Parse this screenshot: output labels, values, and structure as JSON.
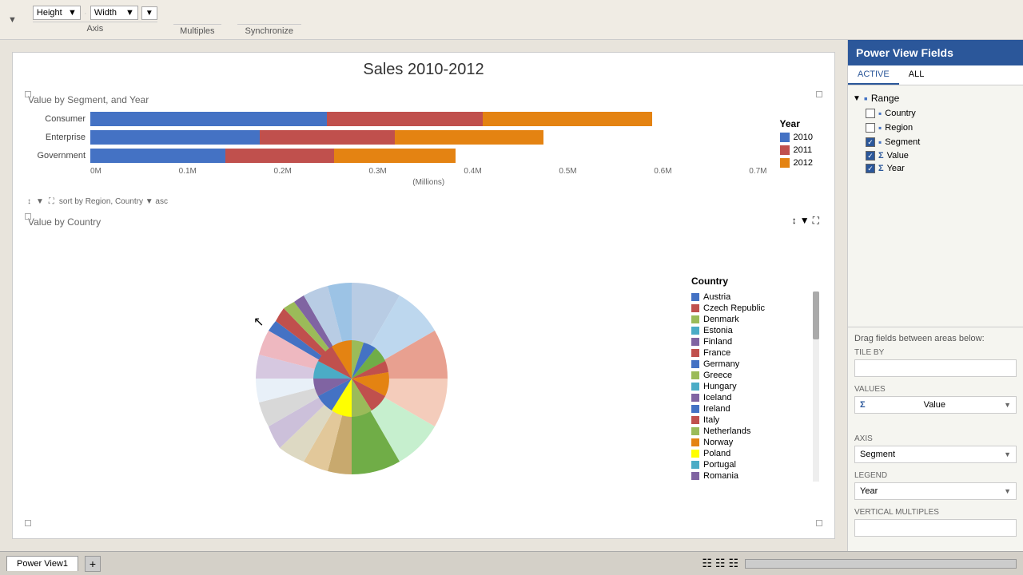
{
  "toolbar": {
    "groups": [
      {
        "label": "Axis",
        "buttons": [
          "Height",
          "Width"
        ]
      },
      {
        "label": "Multiples",
        "buttons": []
      },
      {
        "label": "Synchronize",
        "buttons": []
      }
    ]
  },
  "chart": {
    "title": "Sales 2010-2012",
    "bar_section_title": "Value by Segment, and Year",
    "pie_section_title": "Value by Country",
    "sort_text": "sort by  Region, Country  ▼  asc",
    "year_legend": {
      "title": "Year",
      "items": [
        {
          "label": "2010",
          "color": "#4472C4"
        },
        {
          "label": "2011",
          "color": "#C0504D"
        },
        {
          "label": "2012",
          "color": "#E48312"
        }
      ]
    },
    "bar_rows": [
      {
        "label": "Consumer",
        "segments": [
          {
            "color": "#4472C4",
            "width": "35%"
          },
          {
            "color": "#C0504D",
            "width": "23%"
          },
          {
            "color": "#E48312",
            "width": "25%"
          }
        ]
      },
      {
        "label": "Enterprise",
        "segments": [
          {
            "color": "#4472C4",
            "width": "25%"
          },
          {
            "color": "#C0504D",
            "width": "20%"
          },
          {
            "color": "#E48312",
            "width": "22%"
          }
        ]
      },
      {
        "label": "Government",
        "segments": [
          {
            "color": "#4472C4",
            "width": "20%"
          },
          {
            "color": "#C0504D",
            "width": "16%"
          },
          {
            "color": "#E48312",
            "width": "18%"
          }
        ]
      }
    ],
    "axis_labels": [
      "0M",
      "0.1M",
      "0.2M",
      "0.3M",
      "0.4M",
      "0.5M",
      "0.6M",
      "0.7M"
    ],
    "axis_unit": "(Millions)",
    "country_legend": {
      "title": "Country",
      "items": [
        {
          "label": "Austria",
          "color": "#4472C4"
        },
        {
          "label": "Czech Republic",
          "color": "#C0504D"
        },
        {
          "label": "Denmark",
          "color": "#9BBB59"
        },
        {
          "label": "Estonia",
          "color": "#4BACC6"
        },
        {
          "label": "Finland",
          "color": "#8064A2"
        },
        {
          "label": "France",
          "color": "#C0504D"
        },
        {
          "label": "Germany",
          "color": "#4472C4"
        },
        {
          "label": "Greece",
          "color": "#9BBB59"
        },
        {
          "label": "Hungary",
          "color": "#4BACC6"
        },
        {
          "label": "Iceland",
          "color": "#8064A2"
        },
        {
          "label": "Ireland",
          "color": "#4472C4"
        },
        {
          "label": "Italy",
          "color": "#C0504D"
        },
        {
          "label": "Netherlands",
          "color": "#9BBB59"
        },
        {
          "label": "Norway",
          "color": "#E48312"
        },
        {
          "label": "Poland",
          "color": "#FFFF00"
        },
        {
          "label": "Portugal",
          "color": "#4BACC6"
        },
        {
          "label": "Romania",
          "color": "#8064A2"
        }
      ]
    }
  },
  "fields_panel": {
    "title": "Power View Fields",
    "tab_active": "ACTIVE",
    "tab_all": "ALL",
    "tree_root": "Range",
    "tree_items": [
      {
        "label": "Country",
        "checked": false,
        "type": "field"
      },
      {
        "label": "Region",
        "checked": false,
        "type": "field"
      },
      {
        "label": "Segment",
        "checked": true,
        "type": "field"
      },
      {
        "label": "Value",
        "checked": true,
        "type": "measure"
      },
      {
        "label": "Year",
        "checked": true,
        "type": "measure"
      }
    ],
    "drag_label": "Drag fields between areas below:",
    "areas": [
      {
        "label": "TILE BY",
        "value": ""
      },
      {
        "label": "VALUES",
        "value": "Value"
      },
      {
        "label": "AXIS",
        "value": "Segment"
      },
      {
        "label": "LEGEND",
        "value": "Year"
      },
      {
        "label": "VERTICAL MULTIPLES",
        "value": ""
      }
    ]
  },
  "status_bar": {
    "sheet_tab": "Power View1"
  }
}
